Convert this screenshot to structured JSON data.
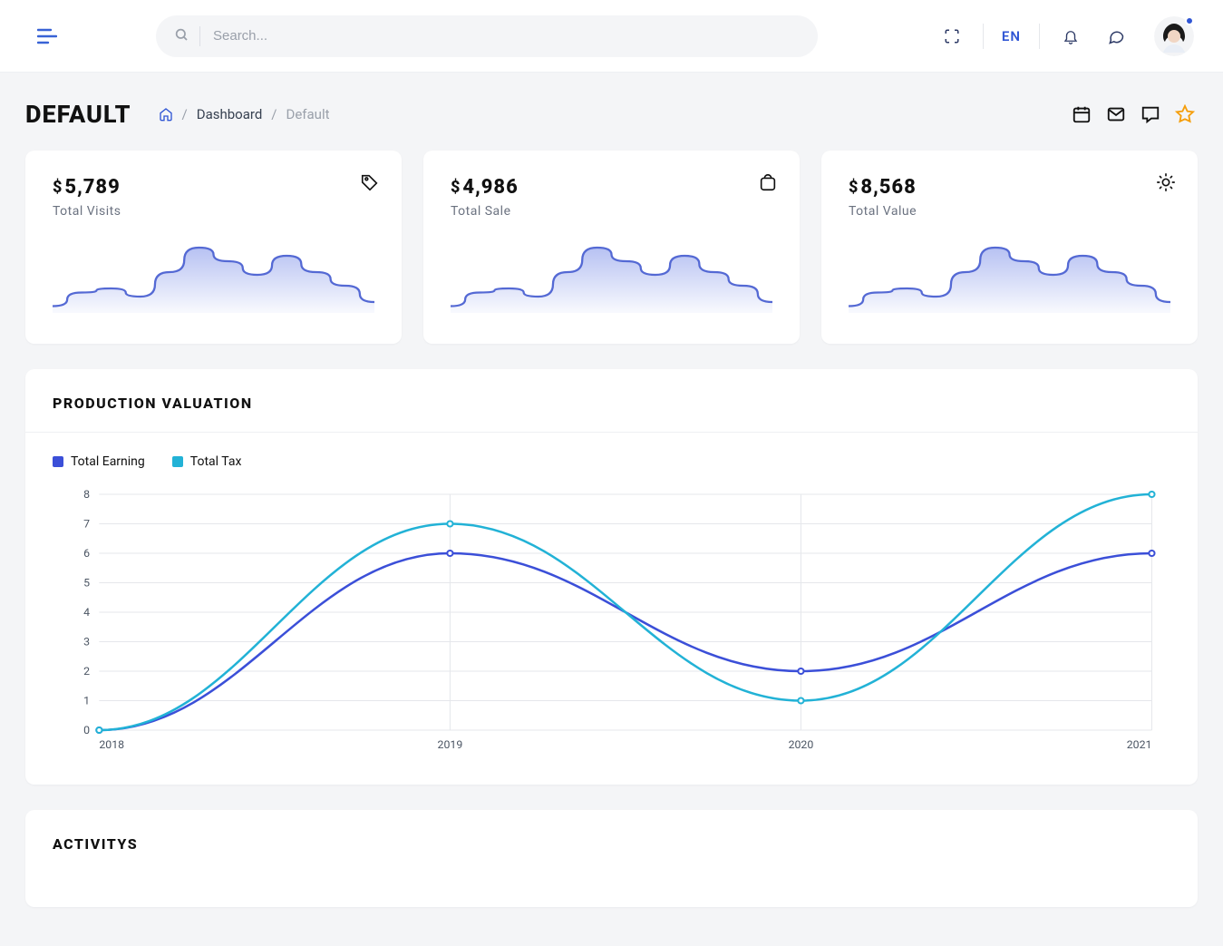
{
  "header": {
    "search_placeholder": "Search...",
    "language": "EN"
  },
  "page": {
    "title": "DEFAULT",
    "breadcrumb": {
      "dashboard": "Dashboard",
      "current": "Default"
    }
  },
  "stats": {
    "visits": {
      "value": "5,789",
      "label": "Total Visits"
    },
    "sale": {
      "value": "4,986",
      "label": "Total Sale"
    },
    "value": {
      "value": "8,568",
      "label": "Total Value"
    }
  },
  "production_valuation": {
    "title": "PRODUCTION VALUATION",
    "legend": {
      "earning": "Total Earning",
      "tax": "Total Tax"
    }
  },
  "activitys": {
    "title": "ACTIVITYS"
  },
  "chart_data": [
    {
      "type": "area",
      "name": "stat-spark",
      "x": [
        0,
        1,
        2,
        3,
        4,
        5,
        6,
        7,
        8,
        9,
        10,
        11
      ],
      "values": [
        5,
        15,
        18,
        12,
        30,
        48,
        38,
        28,
        42,
        30,
        20,
        8
      ]
    },
    {
      "type": "line",
      "name": "production-valuation",
      "title": "PRODUCTION VALUATION",
      "categories": [
        "2018",
        "2019",
        "2020",
        "2021"
      ],
      "series": [
        {
          "name": "Total Earning",
          "color": "#3b4fd8",
          "values": [
            0,
            6,
            2,
            6
          ]
        },
        {
          "name": "Total Tax",
          "color": "#22b2d6",
          "values": [
            0,
            7,
            1,
            8
          ]
        }
      ],
      "ylabel": "",
      "xlabel": "",
      "ylim": [
        0,
        8
      ],
      "yticks": [
        0,
        1,
        2,
        3,
        4,
        5,
        6,
        7,
        8
      ]
    }
  ]
}
